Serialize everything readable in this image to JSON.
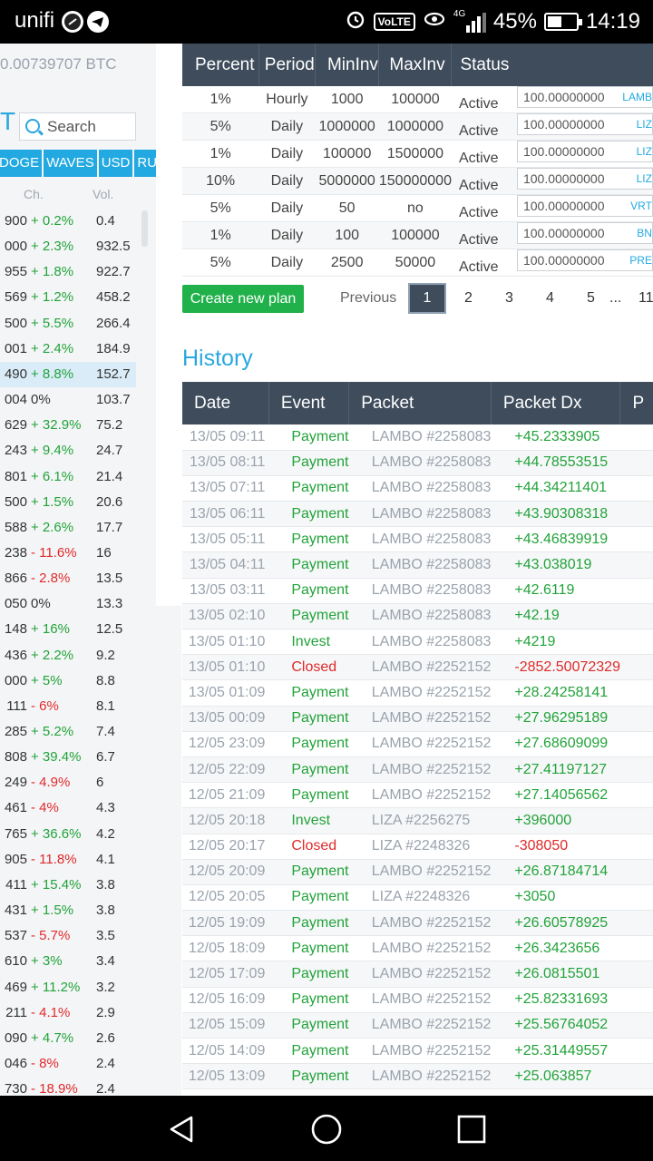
{
  "status_bar": {
    "carrier": "unifi",
    "volte": "VoLTE",
    "network": "4G",
    "battery": "45%",
    "time": "14:19"
  },
  "left_panel": {
    "balance": "0.00739707 BTC",
    "big_letter": "T",
    "search_placeholder": "Search",
    "currency_tabs": [
      "DOGE",
      "WAVES",
      "USD",
      "RUR"
    ],
    "headers": {
      "change": "Ch.",
      "volume": "Vol."
    },
    "rows": [
      {
        "price": "900",
        "change": "+ 0.2%",
        "volume": "0.4",
        "dir": "pos"
      },
      {
        "price": "000",
        "change": "+ 2.3%",
        "volume": "932.5",
        "dir": "pos"
      },
      {
        "price": "955",
        "change": "+ 1.8%",
        "volume": "922.7",
        "dir": "pos"
      },
      {
        "price": "569",
        "change": "+ 1.2%",
        "volume": "458.2",
        "dir": "pos"
      },
      {
        "price": "500",
        "change": "+ 5.5%",
        "volume": "266.4",
        "dir": "pos"
      },
      {
        "price": "001",
        "change": "+ 2.4%",
        "volume": "184.9",
        "dir": "pos"
      },
      {
        "price": "490",
        "change": "+ 8.8%",
        "volume": "152.7",
        "dir": "pos",
        "highlight": true
      },
      {
        "price": "004",
        "change": "0%",
        "volume": "103.7",
        "dir": "zero"
      },
      {
        "price": "629",
        "change": "+ 32.9%",
        "volume": "75.2",
        "dir": "pos"
      },
      {
        "price": "243",
        "change": "+ 9.4%",
        "volume": "24.7",
        "dir": "pos"
      },
      {
        "price": "801",
        "change": "+ 6.1%",
        "volume": "21.4",
        "dir": "pos"
      },
      {
        "price": "500",
        "change": "+ 1.5%",
        "volume": "20.6",
        "dir": "pos"
      },
      {
        "price": "588",
        "change": "+ 2.6%",
        "volume": "17.7",
        "dir": "pos"
      },
      {
        "price": "238",
        "change": "- 11.6%",
        "volume": "16",
        "dir": "neg"
      },
      {
        "price": "866",
        "change": "- 2.8%",
        "volume": "13.5",
        "dir": "neg"
      },
      {
        "price": "050",
        "change": "0%",
        "volume": "13.3",
        "dir": "zero"
      },
      {
        "price": "148",
        "change": "+ 16%",
        "volume": "12.5",
        "dir": "pos"
      },
      {
        "price": "436",
        "change": "+ 2.2%",
        "volume": "9.2",
        "dir": "pos"
      },
      {
        "price": "000",
        "change": "+ 5%",
        "volume": "8.8",
        "dir": "pos"
      },
      {
        "price": "111",
        "change": "- 6%",
        "volume": "8.1",
        "dir": "neg"
      },
      {
        "price": "285",
        "change": "+ 5.2%",
        "volume": "7.4",
        "dir": "pos"
      },
      {
        "price": "808",
        "change": "+ 39.4%",
        "volume": "6.7",
        "dir": "pos"
      },
      {
        "price": "249",
        "change": "- 4.9%",
        "volume": "6",
        "dir": "neg"
      },
      {
        "price": "461",
        "change": "- 4%",
        "volume": "4.3",
        "dir": "neg"
      },
      {
        "price": "765",
        "change": "+ 36.6%",
        "volume": "4.2",
        "dir": "pos"
      },
      {
        "price": "905",
        "change": "- 11.8%",
        "volume": "4.1",
        "dir": "neg"
      },
      {
        "price": "411",
        "change": "+ 15.4%",
        "volume": "3.8",
        "dir": "pos"
      },
      {
        "price": "431",
        "change": "+ 1.5%",
        "volume": "3.8",
        "dir": "pos"
      },
      {
        "price": "537",
        "change": "- 5.7%",
        "volume": "3.5",
        "dir": "neg"
      },
      {
        "price": "610",
        "change": "+ 3%",
        "volume": "3.4",
        "dir": "pos"
      },
      {
        "price": "469",
        "change": "+ 11.2%",
        "volume": "3.2",
        "dir": "pos"
      },
      {
        "price": "211",
        "change": "- 4.1%",
        "volume": "2.9",
        "dir": "neg"
      },
      {
        "price": "090",
        "change": "+ 4.7%",
        "volume": "2.6",
        "dir": "pos"
      },
      {
        "price": "046",
        "change": "- 8%",
        "volume": "2.4",
        "dir": "neg"
      },
      {
        "price": "730",
        "change": "- 18.9%",
        "volume": "2.4",
        "dir": "neg"
      }
    ]
  },
  "plans": {
    "headers": [
      "Percent",
      "Period",
      "MinInv",
      "MaxInv",
      "Status"
    ],
    "rows": [
      {
        "percent": "1%",
        "period": "Hourly",
        "min": "1000",
        "max": "100000",
        "status": "Active",
        "amount": "100.00000000",
        "packet": "LAMB"
      },
      {
        "percent": "5%",
        "period": "Daily",
        "min": "1000000",
        "max": "1000000",
        "status": "Active",
        "amount": "100.00000000",
        "packet": "LIZ"
      },
      {
        "percent": "1%",
        "period": "Daily",
        "min": "100000",
        "max": "1500000",
        "status": "Active",
        "amount": "100.00000000",
        "packet": "LIZ"
      },
      {
        "percent": "10%",
        "period": "Daily",
        "min": "5000000",
        "max": "150000000",
        "status": "Active",
        "amount": "100.00000000",
        "packet": "LIZ"
      },
      {
        "percent": "5%",
        "period": "Daily",
        "min": "50",
        "max": "no",
        "status": "Active",
        "amount": "100.00000000",
        "packet": "VRT"
      },
      {
        "percent": "1%",
        "period": "Daily",
        "min": "100",
        "max": "100000",
        "status": "Active",
        "amount": "100.00000000",
        "packet": "BN"
      },
      {
        "percent": "5%",
        "period": "Daily",
        "min": "2500",
        "max": "50000",
        "status": "Active",
        "amount": "100.00000000",
        "packet": "PRE"
      }
    ],
    "create_button": "Create new plan",
    "pagination": {
      "previous": "Previous",
      "pages": [
        "1",
        "2",
        "3",
        "4",
        "5"
      ],
      "ellipsis": "...",
      "last": "11",
      "active": "1"
    }
  },
  "history": {
    "title": "History",
    "headers": [
      "Date",
      "Event",
      "Packet",
      "Packet Dx",
      "P"
    ],
    "rows": [
      {
        "date": "13/05 09:11",
        "event": "Payment",
        "packet": "LAMBO #2258083",
        "dx": "+45.2333905"
      },
      {
        "date": "13/05 08:11",
        "event": "Payment",
        "packet": "LAMBO #2258083",
        "dx": "+44.78553515"
      },
      {
        "date": "13/05 07:11",
        "event": "Payment",
        "packet": "LAMBO #2258083",
        "dx": "+44.34211401"
      },
      {
        "date": "13/05 06:11",
        "event": "Payment",
        "packet": "LAMBO #2258083",
        "dx": "+43.90308318"
      },
      {
        "date": "13/05 05:11",
        "event": "Payment",
        "packet": "LAMBO #2258083",
        "dx": "+43.46839919"
      },
      {
        "date": "13/05 04:11",
        "event": "Payment",
        "packet": "LAMBO #2258083",
        "dx": "+43.038019"
      },
      {
        "date": "13/05 03:11",
        "event": "Payment",
        "packet": "LAMBO #2258083",
        "dx": "+42.6119"
      },
      {
        "date": "13/05 02:10",
        "event": "Payment",
        "packet": "LAMBO #2258083",
        "dx": "+42.19"
      },
      {
        "date": "13/05 01:10",
        "event": "Invest",
        "packet": "LAMBO #2258083",
        "dx": "+4219"
      },
      {
        "date": "13/05 01:10",
        "event": "Closed",
        "packet": "LAMBO #2252152",
        "dx": "-2852.50072329"
      },
      {
        "date": "13/05 01:09",
        "event": "Payment",
        "packet": "LAMBO #2252152",
        "dx": "+28.24258141"
      },
      {
        "date": "13/05 00:09",
        "event": "Payment",
        "packet": "LAMBO #2252152",
        "dx": "+27.96295189"
      },
      {
        "date": "12/05 23:09",
        "event": "Payment",
        "packet": "LAMBO #2252152",
        "dx": "+27.68609099"
      },
      {
        "date": "12/05 22:09",
        "event": "Payment",
        "packet": "LAMBO #2252152",
        "dx": "+27.41197127"
      },
      {
        "date": "12/05 21:09",
        "event": "Payment",
        "packet": "LAMBO #2252152",
        "dx": "+27.14056562"
      },
      {
        "date": "12/05 20:18",
        "event": "Invest",
        "packet": "LIZA #2256275",
        "dx": "+396000"
      },
      {
        "date": "12/05 20:17",
        "event": "Closed",
        "packet": "LIZA #2248326",
        "dx": "-308050"
      },
      {
        "date": "12/05 20:09",
        "event": "Payment",
        "packet": "LAMBO #2252152",
        "dx": "+26.87184714"
      },
      {
        "date": "12/05 20:05",
        "event": "Payment",
        "packet": "LIZA #2248326",
        "dx": "+3050"
      },
      {
        "date": "12/05 19:09",
        "event": "Payment",
        "packet": "LAMBO #2252152",
        "dx": "+26.60578925"
      },
      {
        "date": "12/05 18:09",
        "event": "Payment",
        "packet": "LAMBO #2252152",
        "dx": "+26.3423656"
      },
      {
        "date": "12/05 17:09",
        "event": "Payment",
        "packet": "LAMBO #2252152",
        "dx": "+26.0815501"
      },
      {
        "date": "12/05 16:09",
        "event": "Payment",
        "packet": "LAMBO #2252152",
        "dx": "+25.82331693"
      },
      {
        "date": "12/05 15:09",
        "event": "Payment",
        "packet": "LAMBO #2252152",
        "dx": "+25.56764052"
      },
      {
        "date": "12/05 14:09",
        "event": "Payment",
        "packet": "LAMBO #2252152",
        "dx": "+25.31449557"
      },
      {
        "date": "12/05 13:09",
        "event": "Payment",
        "packet": "LAMBO #2252152",
        "dx": "+25.063857"
      }
    ]
  },
  "colors": {
    "accent": "#23a9e1",
    "header": "#3e4c5c",
    "positive": "#22a33a",
    "negative": "#e02a2a",
    "button": "#20b14a"
  }
}
